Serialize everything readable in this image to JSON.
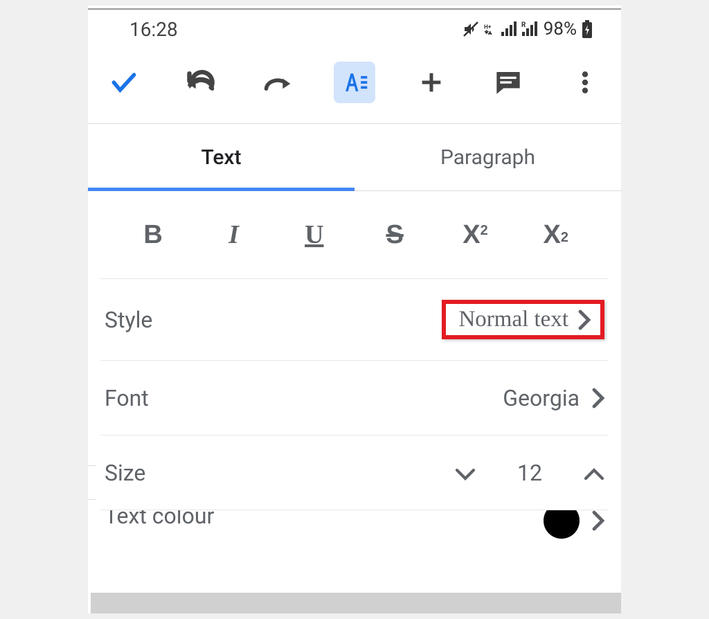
{
  "status_bar": {
    "time": "16:28",
    "battery_pct": "98%"
  },
  "tabs": {
    "text": "Text",
    "paragraph": "Paragraph"
  },
  "format": {
    "bold": "B",
    "italic": "I",
    "underline": "U",
    "strike": "S",
    "super_x": "X",
    "super_n": "2",
    "sub_x": "X",
    "sub_n": "2"
  },
  "rows": {
    "style_label": "Style",
    "style_value": "Normal text",
    "font_label": "Font",
    "font_value": "Georgia",
    "size_label": "Size",
    "size_value": "12",
    "textcolor_label": "Text colour"
  }
}
